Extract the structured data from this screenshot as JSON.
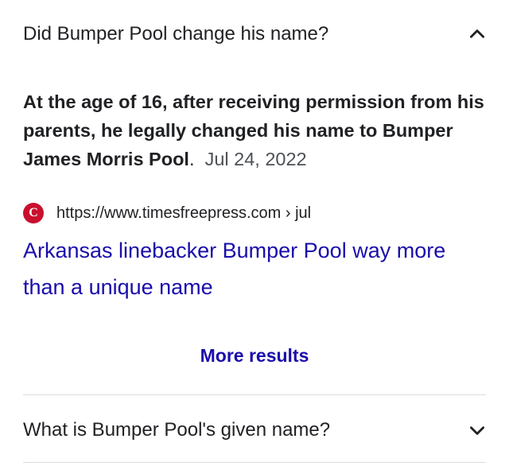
{
  "faq": [
    {
      "question": "Did Bumper Pool change his name?",
      "expanded": true,
      "answer": {
        "bold_text": "At the age of 16, after receiving permission from his parents, he legally changed his name to Bumper James Morris Pool",
        "after_bold": ".",
        "date": "Jul 24, 2022"
      },
      "source": {
        "favicon_letter": "C",
        "url": "https://www.timesfreepress.com › jul",
        "title": "Arkansas linebacker Bumper Pool way more than a unique name"
      },
      "more_results_label": "More results"
    },
    {
      "question": "What is Bumper Pool's given name?",
      "expanded": false
    }
  ],
  "colors": {
    "text": "#202124",
    "link": "#1a0dab",
    "favicon_bg": "#c8102e",
    "divider": "#dadce0"
  },
  "icons": {
    "expanded": "chevron-up-icon",
    "collapsed": "chevron-down-icon"
  }
}
